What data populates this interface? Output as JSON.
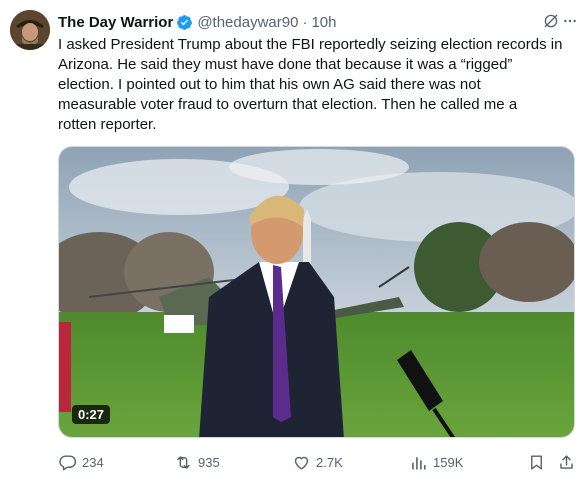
{
  "tweet": {
    "author_name": "The Day Warrior",
    "handle": "@thedaywar90",
    "separator": "·",
    "time": "10h",
    "text": "I asked President Trump about the FBI reportedly seizing election records in\nArizona. He said they must have done that because it was a “rigged”\nelection. I pointed out to him that his own AG said there was not\nmeasurable voter fraud to overturn that election. Then he called me a\nrotten reporter.",
    "video_duration": "0:27"
  },
  "actions": {
    "replies": "234",
    "reposts": "935",
    "likes": "2.7K",
    "views": "159K"
  },
  "icons": {
    "verified": "verified-badge-icon",
    "grok": "grok-icon",
    "more": "more-icon",
    "reply": "reply-icon",
    "repost": "repost-icon",
    "like": "heart-icon",
    "views": "views-icon",
    "bookmark": "bookmark-icon",
    "share": "share-icon"
  },
  "colors": {
    "verified_blue": "#1d9bf0",
    "muted_text": "#536471",
    "text": "#0f1419"
  }
}
